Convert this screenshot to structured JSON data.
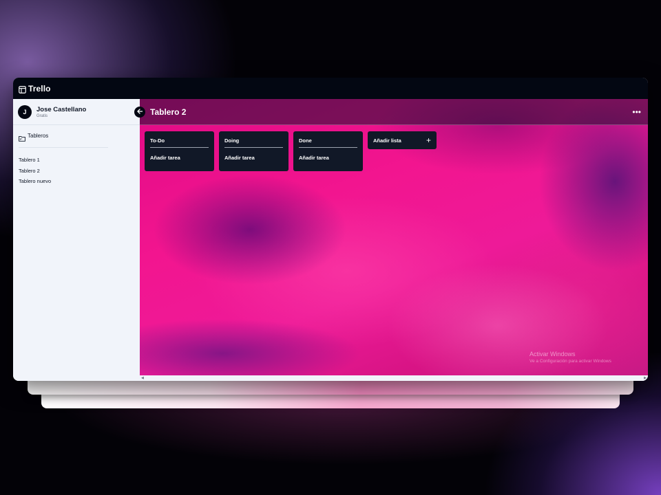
{
  "app": {
    "name": "Trello",
    "icon": "layout-icon"
  },
  "user": {
    "initial": "J",
    "name": "Jose Castellano",
    "plan": "Gratis"
  },
  "sidebar": {
    "section_label": "Tableros",
    "section_icon": "folder-icon",
    "boards": [
      "Tablero 1",
      "Tablero 2",
      "Tablero nuevo"
    ]
  },
  "board": {
    "title": "Tablero 2",
    "menu_label": "•••",
    "lists": [
      {
        "title": "To-Do",
        "add_label": "Añadir tarea"
      },
      {
        "title": "Doing",
        "add_label": "Añadir tarea"
      },
      {
        "title": "Done",
        "add_label": "Añadir tarea"
      }
    ],
    "add_list_label": "Añadir lista",
    "add_list_symbol": "+"
  },
  "watermark": {
    "title": "Activar Windows",
    "subtitle": "Ve a Configuración para activar Windows"
  },
  "colors": {
    "topbar": "#030712",
    "sidebar": "#f1f4fa",
    "list_bg": "#111827",
    "board_accent": "#e10a86"
  }
}
